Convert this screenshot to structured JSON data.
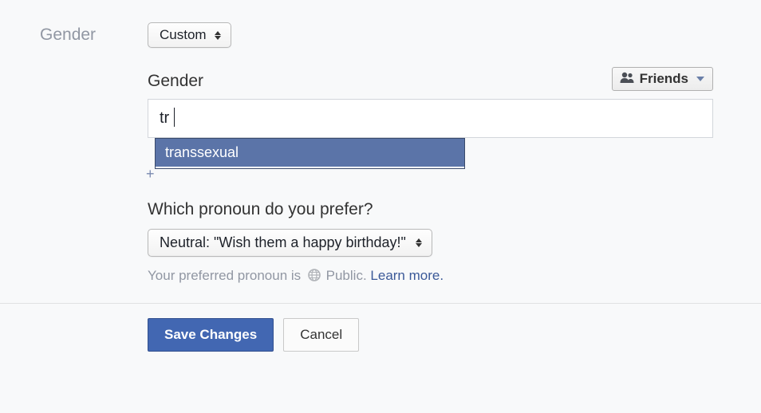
{
  "section_label": "Gender",
  "gender_select": {
    "value": "Custom"
  },
  "gender_field": {
    "label": "Gender",
    "value": "tr",
    "autocomplete_option": "transsexual",
    "privacy_label": "Friends"
  },
  "pronoun": {
    "question": "Which pronoun do you prefer?",
    "value": "Neutral: \"Wish them a happy birthday!\"",
    "note_prefix": "Your preferred pronoun is",
    "note_public": "Public.",
    "learn_more": "Learn more."
  },
  "buttons": {
    "save": "Save Changes",
    "cancel": "Cancel"
  }
}
